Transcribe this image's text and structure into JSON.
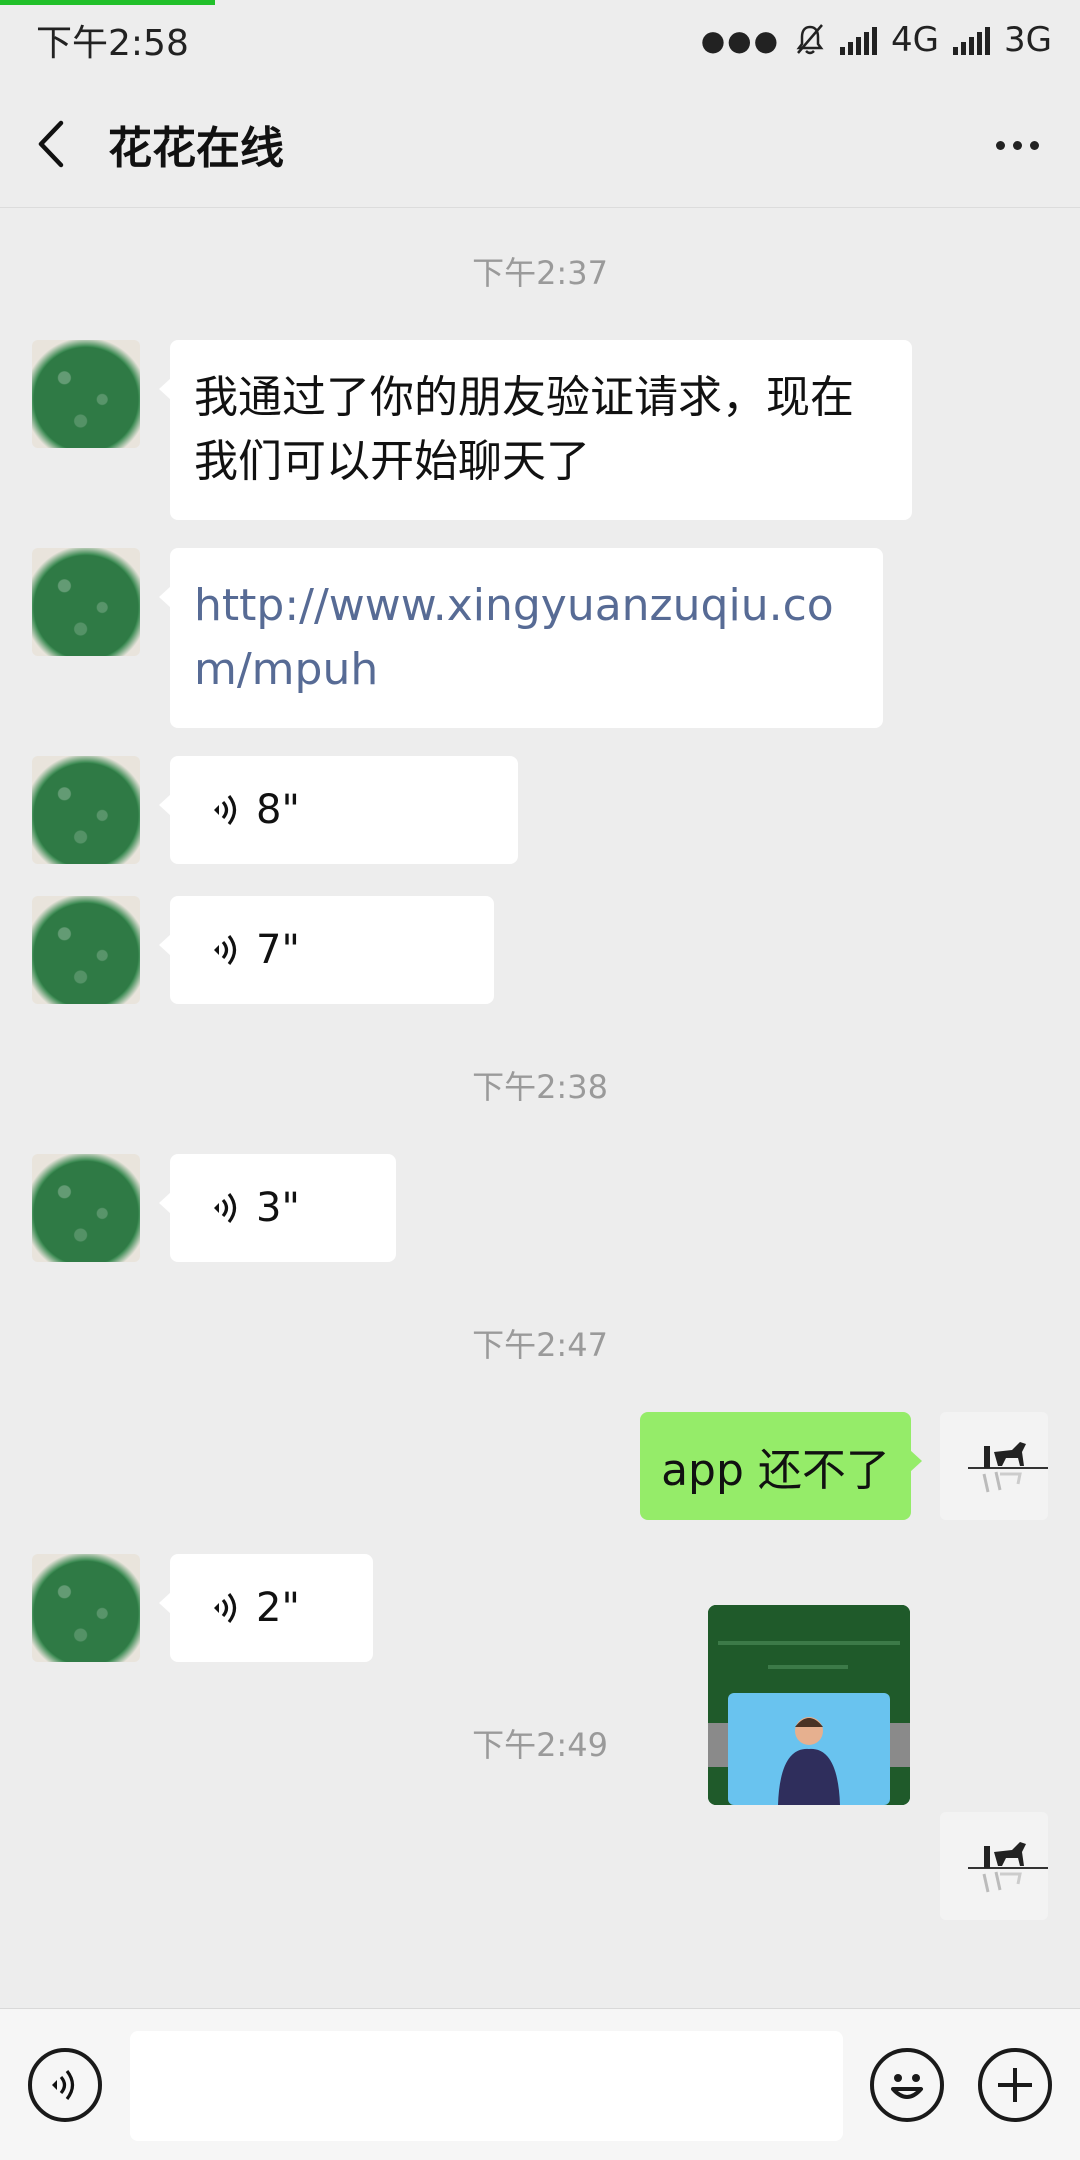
{
  "status_bar": {
    "time": "下午2:58",
    "network_1": "4G",
    "network_2": "3G",
    "icons": [
      "more-dots-icon",
      "mute-bell-icon",
      "signal-icon",
      "signal-icon"
    ]
  },
  "header": {
    "title": "花花在线",
    "back_icon": "chevron-left-icon",
    "more_icon": "more-horizontal-icon"
  },
  "timestamps": [
    "下午2:37",
    "下午2:38",
    "下午2:47",
    "下午2:49"
  ],
  "messages": [
    {
      "side": "left",
      "type": "text",
      "text": "我通过了你的朋友验证请求，现在我们可以开始聊天了"
    },
    {
      "side": "left",
      "type": "link",
      "text": "http://www.xingyuanzuqiu.com/mpuh"
    },
    {
      "side": "left",
      "type": "voice",
      "duration": "8\""
    },
    {
      "side": "left",
      "type": "voice",
      "duration": "7\""
    },
    {
      "side": "left",
      "type": "voice",
      "duration": "3\""
    },
    {
      "side": "right",
      "type": "text",
      "text": "app 还不了"
    },
    {
      "side": "left",
      "type": "voice",
      "duration": "2\""
    },
    {
      "side": "right",
      "type": "image",
      "description_icon": "screenshot-thumbnail"
    }
  ],
  "input_bar": {
    "voice_icon": "voice-mode-icon",
    "emoji_icon": "emoji-icon",
    "plus_icon": "plus-icon",
    "placeholder": ""
  },
  "colors": {
    "background": "#ededed",
    "sent_bubble": "#95ec69",
    "received_bubble": "#ffffff",
    "link": "#576b95"
  }
}
